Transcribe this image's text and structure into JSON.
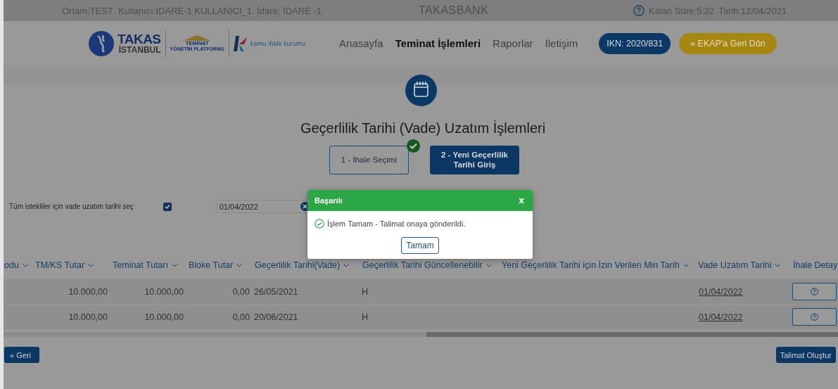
{
  "top_bar": {
    "session_info": "Ortam:TEST  Kullanıcı:IDARE-1 KULLANICI_1  İdare: İDARE -1",
    "title": "TAKASBANK",
    "remaining_time": "Kalan Süre:5:32",
    "date": "Tarih:12/04/2021"
  },
  "header": {
    "logo_takas": [
      "TAKAS",
      "İSTANBUL"
    ],
    "logo_platform": [
      "TEMİNAT",
      "YÖNETİM PLATFORMU"
    ],
    "logo_kik": "kamu ihale kurumu",
    "nav": [
      {
        "label": "Anasayfa",
        "selected": false
      },
      {
        "label": "Teminat İşlemleri",
        "selected": true
      },
      {
        "label": "Raporlar",
        "selected": false
      },
      {
        "label": "İletişim",
        "selected": false
      }
    ],
    "ikn_button": "IKN: 2020/831",
    "back_button": "« EKAP'a Geri Dön"
  },
  "page": {
    "title": "Geçerlilik Tarihi (Vade) Uzatım İşlemleri",
    "steps": [
      {
        "label": "1 - İhale Seçimi",
        "completed": true,
        "selected": false
      },
      {
        "label": "2 - Yeni Geçerlilik Tarihi Giriş",
        "completed": false,
        "selected": true
      }
    ]
  },
  "options": {
    "label": "Tüm istekliler için vade uzatım tarihi seç",
    "checked": true,
    "date_value": "01/04/2022"
  },
  "table": {
    "columns": [
      "odu",
      "TM/KS Tutar",
      "Teminat Tutarı",
      "Bloke Tutar",
      "Geçerlilik Tarihi(Vade)",
      "Geçerlilik Tarihi Güncellenebilir",
      "Yeni Geçerlilik Tarihi için İzin Verilen Min Tarih",
      "Vade Uzatım Tarihi",
      "İhale Detay"
    ],
    "rows": [
      {
        "tm_ks_tutar": "10.000,00",
        "teminat_tutari": "10.000,00",
        "bloke_tutar": "0,00",
        "gecerlilik_tarihi": "26/05/2021",
        "guncellenebilir": "H",
        "vade_uzatim_tarihi": "01/04/2022"
      },
      {
        "tm_ks_tutar": "10.000,00",
        "teminat_tutari": "10.000,00",
        "bloke_tutar": "0,00",
        "gecerlilik_tarihi": "20/06/2021",
        "guncellenebilir": "H",
        "vade_uzatim_tarihi": "01/04/2022"
      }
    ]
  },
  "footer": {
    "back_button": "« Geri",
    "submit_button": "Talimat Oluştur"
  },
  "dialog": {
    "title": "Başarılı",
    "close": "x",
    "message": "İşlem Tamam - Talimat onaya gönderildi.",
    "ok_button": "Tamam"
  }
}
